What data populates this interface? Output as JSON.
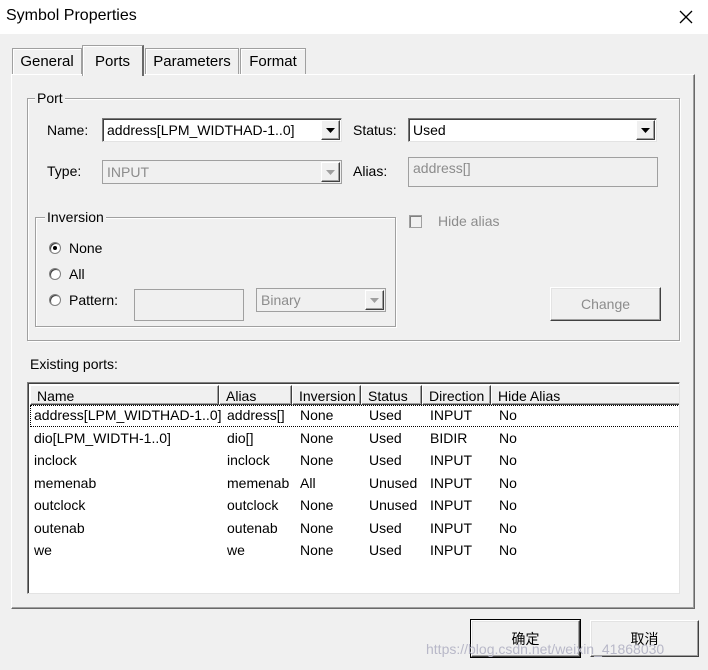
{
  "window": {
    "title": "Symbol Properties"
  },
  "tabs": [
    {
      "label": "General",
      "active": false
    },
    {
      "label": "Ports",
      "active": true
    },
    {
      "label": "Parameters",
      "active": false
    },
    {
      "label": "Format",
      "active": false
    }
  ],
  "port_group": {
    "legend": "Port",
    "name_label": "Name:",
    "name_value": "address[LPM_WIDTHAD-1..0]",
    "status_label": "Status:",
    "status_value": "Used",
    "type_label": "Type:",
    "type_value": "INPUT",
    "alias_label": "Alias:",
    "alias_value": "address[]",
    "hide_alias_label": "Hide alias",
    "hide_alias_checked": false,
    "change_label": "Change"
  },
  "inversion_group": {
    "legend": "Inversion",
    "options": [
      "None",
      "All",
      "Pattern:"
    ],
    "selected": "None",
    "pattern_value": "",
    "pattern_format": "Binary"
  },
  "existing_ports": {
    "label": "Existing ports:",
    "columns": [
      "Name",
      "Alias",
      "Inversion",
      "Status",
      "Direction",
      "Hide Alias"
    ],
    "rows": [
      [
        "address[LPM_WIDTHAD-1..0]",
        "address[]",
        "None",
        "Used",
        "INPUT",
        "No"
      ],
      [
        "dio[LPM_WIDTH-1..0]",
        "dio[]",
        "None",
        "Used",
        "BIDIR",
        "No"
      ],
      [
        "inclock",
        "inclock",
        "None",
        "Used",
        "INPUT",
        "No"
      ],
      [
        "memenab",
        "memenab",
        "All",
        "Unused",
        "INPUT",
        "No"
      ],
      [
        "outclock",
        "outclock",
        "None",
        "Unused",
        "INPUT",
        "No"
      ],
      [
        "outenab",
        "outenab",
        "None",
        "Used",
        "INPUT",
        "No"
      ],
      [
        "we",
        "we",
        "None",
        "Used",
        "INPUT",
        "No"
      ]
    ],
    "selected_row": 0
  },
  "footer": {
    "ok_label": "确定",
    "cancel_label": "取消"
  },
  "watermark": "https://blog.csdn.net/weixin_41868030",
  "icons": {
    "close": "close-icon",
    "dropdown": "chevron-down-icon"
  }
}
